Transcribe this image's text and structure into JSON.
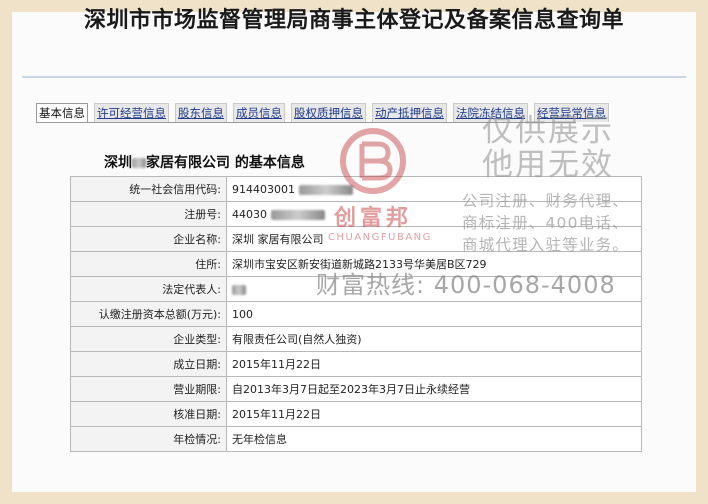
{
  "page_title": "深圳市市场监督管理局商事主体登记及备案信息查询单",
  "tabs": [
    {
      "label": "基本信息",
      "active": true
    },
    {
      "label": "许可经营信息"
    },
    {
      "label": "股东信息"
    },
    {
      "label": "成员信息"
    },
    {
      "label": "股权质押信息"
    },
    {
      "label": "动产抵押信息"
    },
    {
      "label": "法院冻结信息"
    },
    {
      "label": "经营异常信息"
    }
  ],
  "company": {
    "name_prefix": "深圳",
    "name_suffix": "家居有限公司",
    "heading_suffix": " 的基本信息"
  },
  "rows": [
    {
      "key": "统一社会信用代码:",
      "value": "914403001"
    },
    {
      "key": "注册号:",
      "value": "44030"
    },
    {
      "key": "企业名称:",
      "value": "深圳   家居有限公司"
    },
    {
      "key": "住所:",
      "value": "深圳市宝安区新安街道新城路2133号华美居B区729"
    },
    {
      "key": "法定代表人:",
      "value": ""
    },
    {
      "key": "认缴注册资本总额(万元):",
      "value": "100"
    },
    {
      "key": "企业类型:",
      "value": "有限责任公司(自然人独资)"
    },
    {
      "key": "成立日期:",
      "value": "2015年11月22日"
    },
    {
      "key": "营业期限:",
      "value": "自2013年3月7日起至2023年3月7日止永续经营"
    },
    {
      "key": "核准日期:",
      "value": "2015年11月22日"
    },
    {
      "key": "年检情况:",
      "value": "无年检信息"
    }
  ],
  "watermark": {
    "brand_cn": "创富邦",
    "brand_en": "CHUANGFUBANG",
    "notice_line1": "仅供展示",
    "notice_line2": "他用无效",
    "services_line1": "公司注册、财务代理、",
    "services_line2": "商标注册、400电话、",
    "services_line3": "商城代理入驻等业务。",
    "hotline": "财富热线: 400-068-4008"
  },
  "colors": {
    "frame": "#f0e2c8",
    "link": "#1f3a8a",
    "logo_red": "#c03a3a"
  }
}
